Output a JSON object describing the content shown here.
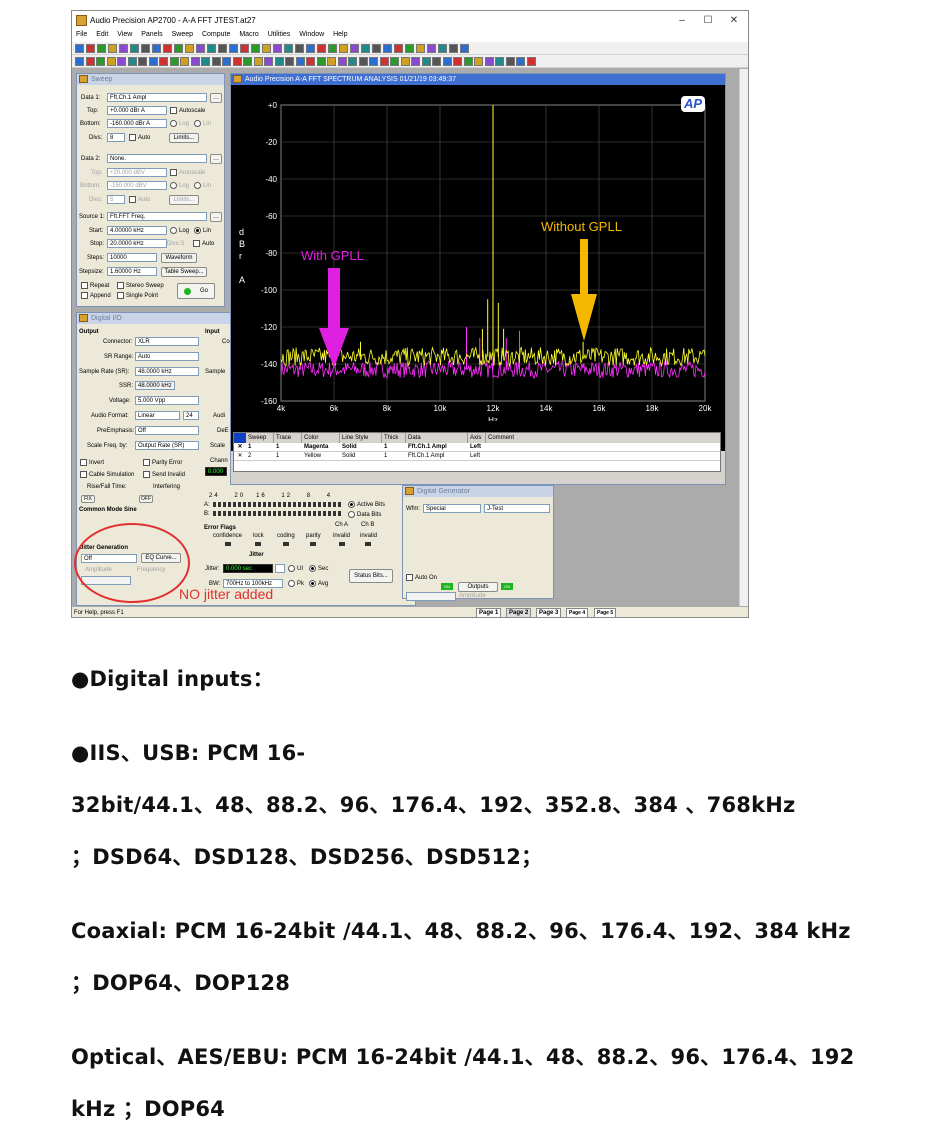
{
  "app": {
    "title": "Audio Precision AP2700 - A-A FFT JTEST.at27",
    "window_controls": [
      "–",
      "☐",
      "✕"
    ],
    "menu": [
      "File",
      "Edit",
      "View",
      "Panels",
      "Sweep",
      "Compute",
      "Macro",
      "Utilities",
      "Window",
      "Help"
    ],
    "status_text": "For Help, press F1",
    "pages": [
      "Page 1",
      "Page 2",
      "Page 3",
      "Page 4",
      "Page 5"
    ]
  },
  "sweep_panel": {
    "title": "Sweep",
    "data1_label": "Data 1:",
    "data1_value": "Fft.Ch.1 Ampl",
    "top_label": "Top:",
    "top_value": "+0.000  dBr A",
    "bottom_label": "Bottom:",
    "bottom_value": "-160.000 dBr A",
    "autoscale": "Autoscale",
    "log": "Log",
    "lin": "Lin",
    "divs_label": "Divs:",
    "divs_value": "8",
    "auto": "Auto",
    "limits": "Limits...",
    "data2_label": "Data 2:",
    "data2_value": "None.",
    "top2_value": "+20.000  dBV",
    "bottom2_value": "-150.000 dBV",
    "divs2_value": "5",
    "source1_label": "Source 1:",
    "source1_value": "Fft.FFT Freq.",
    "start_label": "Start:",
    "start_value": "4.00000 kHz",
    "stop_label": "Stop:",
    "stop_value": "20.0000 kHz",
    "divs3_label": "Divs:",
    "divs3_value": "5",
    "steps_label": "Steps:",
    "steps_value": "10000",
    "waveform": "Waveform",
    "stepsize_label": "Stepsize:",
    "stepsize_value": "1.60000  Hz",
    "table_sweep": "Table Sweep...",
    "repeat": "Repeat",
    "stereo_sweep": "Stereo Sweep",
    "append": "Append",
    "single_point": "Single Point",
    "go": "Go"
  },
  "digital_io": {
    "title": "Digital I/O",
    "output": "Output",
    "input": "Input",
    "connector_label": "Connector:",
    "connector_value": "XLR",
    "sr_range_label": "SR Range:",
    "sr_range_value": "Auto",
    "sample_rate_label": "Sample Rate (SR):",
    "sample_rate_value": "48.0000 kHz",
    "ssr_label": "SSR:",
    "ssr_value": "48.0000 kHz",
    "voltage_label": "Voltage:",
    "voltage_value": "5.000   Vpp",
    "audio_format_label": "Audio Format:",
    "audio_format_value": "Linear",
    "bits_value": "24",
    "preemphasis_label": "PreEmphasis:",
    "preemphasis_value": "Off",
    "scale_freq_label": "Scale Freq. by:",
    "scale_freq_value": "Output Rate (SR)",
    "invert": "Invert",
    "parity_error": "Parity Error",
    "cable_simulation": "Cable Simulation",
    "send_invalid": "Send Invalid",
    "rise_fall": "Rise/Fall Time:",
    "interfering": "Interfering",
    "fix": "FIX",
    "off": "OFF",
    "common_mode": "Common Mode Sine",
    "jitter_generation": "Jitter Generation",
    "jitter_value": "Off",
    "eq_curve": "EQ Curve...",
    "amplitude": "Amplitude",
    "frequency": "Frequency",
    "input_cut": "Co",
    "sample_cut": "Sample",
    "audio_cut": "Audi",
    "de_cut": "DeE",
    "scale_cut": "Scale",
    "chann_cut": "Chann",
    "green_value": "0.000",
    "bit_numbers": [
      "24",
      "20",
      "16",
      "12",
      "8",
      "4"
    ],
    "row_a": "A:",
    "row_b": "B:",
    "active_bits": "Active Bits",
    "data_bits": "Data Bits",
    "error_flags": "Error Flags",
    "flags": [
      "confidence",
      "lock",
      "coding",
      "parity",
      "invalid",
      "invalid"
    ],
    "cha": "Ch A",
    "chb": "Ch B",
    "jitter": "Jitter",
    "jitter_label": "Jitter:",
    "jitter_reading": "0.000    sec",
    "ui": "UI",
    "sec": "Sec",
    "status_bits": "Status Bits...",
    "bw_label": "BW:",
    "bw_value": "700Hz to 100kHz",
    "pk": "Pk",
    "avg": "Avg"
  },
  "annotation": {
    "no_jitter": "NO jitter added",
    "with_gpll": "With GPLL",
    "without_gpll": "Without GPLL",
    "circle_color": "#e03030",
    "with_color": "#e020e0",
    "without_color": "#f5b800"
  },
  "digital_generator": {
    "title": "Digital Generator",
    "wfm_label": "Wfm:",
    "wfm_value": "Special",
    "wfm_type": "J-Test",
    "auto_on": "Auto On",
    "outputs": "Outputs",
    "amplitude": "Amplitude",
    "on1": "ON",
    "on2": "ON"
  },
  "graph_window": {
    "title": "Audio Precision   A-A FFT SPECTRUM ANALYSIS   01/21/19 03:49:37",
    "logo": "AP",
    "y_axis_label": [
      "d",
      "B",
      "r",
      "",
      "A"
    ],
    "x_axis_label": "Hz",
    "table_headers": [
      "Sweep",
      "Trace",
      "Color",
      "Line Style",
      "Thick",
      "Data",
      "Axis",
      "Comment"
    ],
    "table_rows": [
      [
        "1",
        "1",
        "Magenta",
        "Solid",
        "1",
        "Fft.Ch.1 Ampl",
        "Left",
        ""
      ],
      [
        "2",
        "1",
        "Yellow",
        "Solid",
        "1",
        "Fft.Ch.1 Ampl",
        "Left",
        ""
      ]
    ]
  },
  "chart_data": {
    "type": "line",
    "title": "",
    "xlabel": "Hz",
    "ylabel": "dBr A",
    "xlim": [
      4000,
      20000
    ],
    "ylim": [
      -160,
      0
    ],
    "x_ticks": [
      "4k",
      "6k",
      "8k",
      "10k",
      "12k",
      "14k",
      "16k",
      "18k",
      "20k"
    ],
    "y_ticks": [
      "+0",
      "-20",
      "-40",
      "-60",
      "-80",
      "-100",
      "-120",
      "-140",
      "-160"
    ],
    "grid": true,
    "series": [
      {
        "name": "Magenta",
        "color": "#ff30ff",
        "noise_floor_db": -143,
        "peaks": [
          [
            12000,
            -18
          ],
          [
            11000,
            -120
          ],
          [
            13000,
            -122
          ],
          [
            12500,
            -126
          ],
          [
            11500,
            -126
          ]
        ]
      },
      {
        "name": "Yellow",
        "color": "#ffff30",
        "noise_floor_db": -136,
        "peaks": [
          [
            12000,
            0
          ],
          [
            11800,
            -105
          ],
          [
            12200,
            -107
          ],
          [
            11600,
            -121
          ],
          [
            12400,
            -121
          ],
          [
            7000,
            -128
          ],
          [
            15400,
            -128
          ]
        ]
      }
    ]
  },
  "specs": {
    "heading": "●Digital inputs：",
    "iis_line1": "●IIS、USB: PCM 16-",
    "iis_line2": "32bit/44.1、48、88.2、96、176.4、192、352.8、384 、768kHz",
    "iis_line3": "；DSD64、DSD128、DSD256、DSD512；",
    "coax_line1": "Coaxial: PCM 16-24bit /44.1、48、88.2、96、176.4、192、384 kHz",
    "coax_line2": "；DOP64、DOP128",
    "opt_line1": "Optical、AES/EBU: PCM 16-24bit /44.1、48、88.2、96、176.4、192",
    "opt_line2": "kHz ；DOP64"
  }
}
